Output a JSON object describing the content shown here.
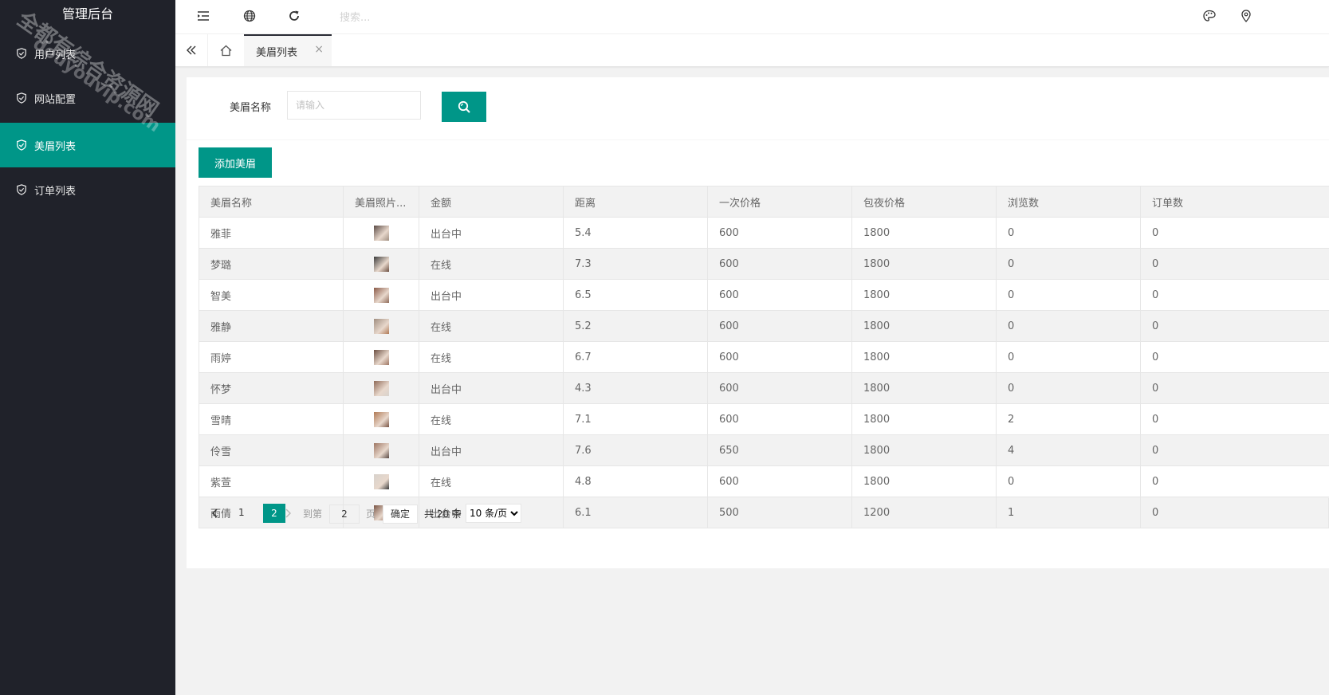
{
  "app": {
    "title": "管理后台"
  },
  "sidebar": {
    "items": [
      {
        "label": "用户列表",
        "icon": "shield-check-icon",
        "active": false
      },
      {
        "label": "网站配置",
        "icon": "shield-check-icon",
        "active": false
      },
      {
        "label": "美眉列表",
        "icon": "shield-check-icon",
        "active": true
      },
      {
        "label": "订单列表",
        "icon": "shield-check-icon",
        "active": false
      }
    ]
  },
  "topbar": {
    "icons": [
      "indent-icon",
      "globe-icon",
      "refresh-icon",
      "palette-icon",
      "pin-icon"
    ],
    "search_placeholder": "搜索..."
  },
  "tabs": {
    "active_label": "美眉列表",
    "close_glyph": "×"
  },
  "search": {
    "label": "美眉名称",
    "placeholder": "请输入",
    "button_icon": "search-icon"
  },
  "toolbar": {
    "add_label": "添加美眉"
  },
  "table": {
    "columns": [
      "美眉名称",
      "美眉照片...",
      "金额",
      "距离",
      "一次价格",
      "包夜价格",
      "浏览数",
      "订单数"
    ],
    "rows": [
      {
        "name": "雅菲",
        "status": "出台中",
        "distance": "5.4",
        "once": "600",
        "night": "1800",
        "views": "0",
        "orders": "0"
      },
      {
        "name": "梦璐",
        "status": "在线",
        "distance": "7.3",
        "once": "600",
        "night": "1800",
        "views": "0",
        "orders": "0"
      },
      {
        "name": "智美",
        "status": "出台中",
        "distance": "6.5",
        "once": "600",
        "night": "1800",
        "views": "0",
        "orders": "0"
      },
      {
        "name": "雅静",
        "status": "在线",
        "distance": "5.2",
        "once": "600",
        "night": "1800",
        "views": "0",
        "orders": "0"
      },
      {
        "name": "雨婷",
        "status": "在线",
        "distance": "6.7",
        "once": "600",
        "night": "1800",
        "views": "0",
        "orders": "0"
      },
      {
        "name": "怀梦",
        "status": "出台中",
        "distance": "4.3",
        "once": "600",
        "night": "1800",
        "views": "0",
        "orders": "0"
      },
      {
        "name": "雪晴",
        "status": "在线",
        "distance": "7.1",
        "once": "600",
        "night": "1800",
        "views": "2",
        "orders": "0"
      },
      {
        "name": "伶雪",
        "status": "出台中",
        "distance": "7.6",
        "once": "650",
        "night": "1800",
        "views": "4",
        "orders": "0"
      },
      {
        "name": "紫萱",
        "status": "在线",
        "distance": "4.8",
        "once": "600",
        "night": "1800",
        "views": "0",
        "orders": "0"
      },
      {
        "name": "雨倩",
        "status": "出台中",
        "distance": "6.1",
        "once": "500",
        "night": "1200",
        "views": "1",
        "orders": "0"
      }
    ]
  },
  "pagination": {
    "page1": "1",
    "current": "2",
    "goto_label": "到第",
    "goto_value": "2",
    "page_suffix": "页",
    "confirm_label": "确定",
    "total_label": "共 20 条",
    "page_size": "10 条/页"
  },
  "watermark": {
    "line1": "全都有综合资源网",
    "line2": "douyouvip.com"
  },
  "colors": {
    "accent": "#009688",
    "sidebar_bg": "#20222a"
  }
}
